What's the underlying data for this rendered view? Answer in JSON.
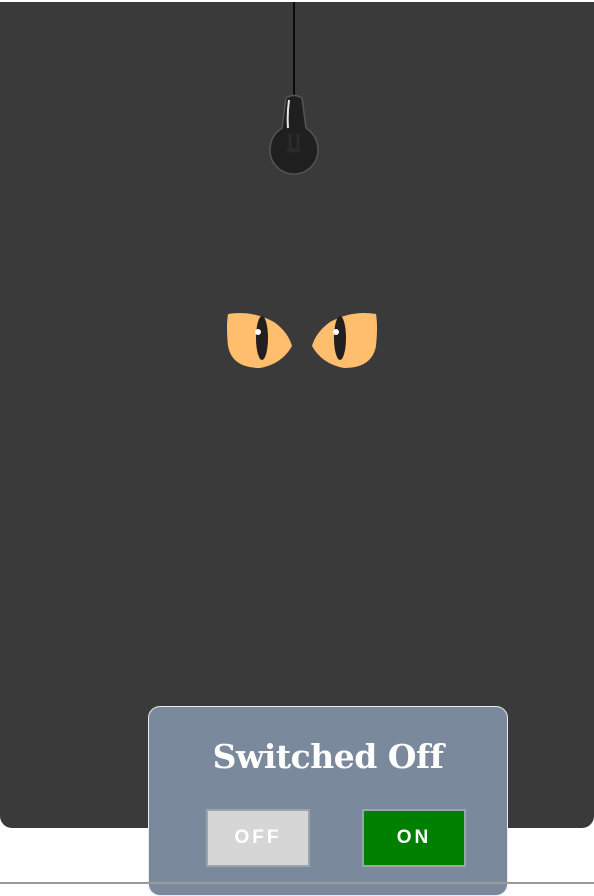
{
  "scene": {
    "background_color": "#3a3a3a",
    "bulb_state": "off",
    "icons": [
      "light-bulb-icon",
      "cat-eyes-icon"
    ],
    "eye_color": "#ffbd6e"
  },
  "panel": {
    "status_text": "Switched Off",
    "off_button_label": "OFF",
    "on_button_label": "ON",
    "colors": {
      "panel_bg": "#7a8a9c",
      "off_button_bg": "#d6d6d6",
      "on_button_bg": "#008000"
    }
  }
}
